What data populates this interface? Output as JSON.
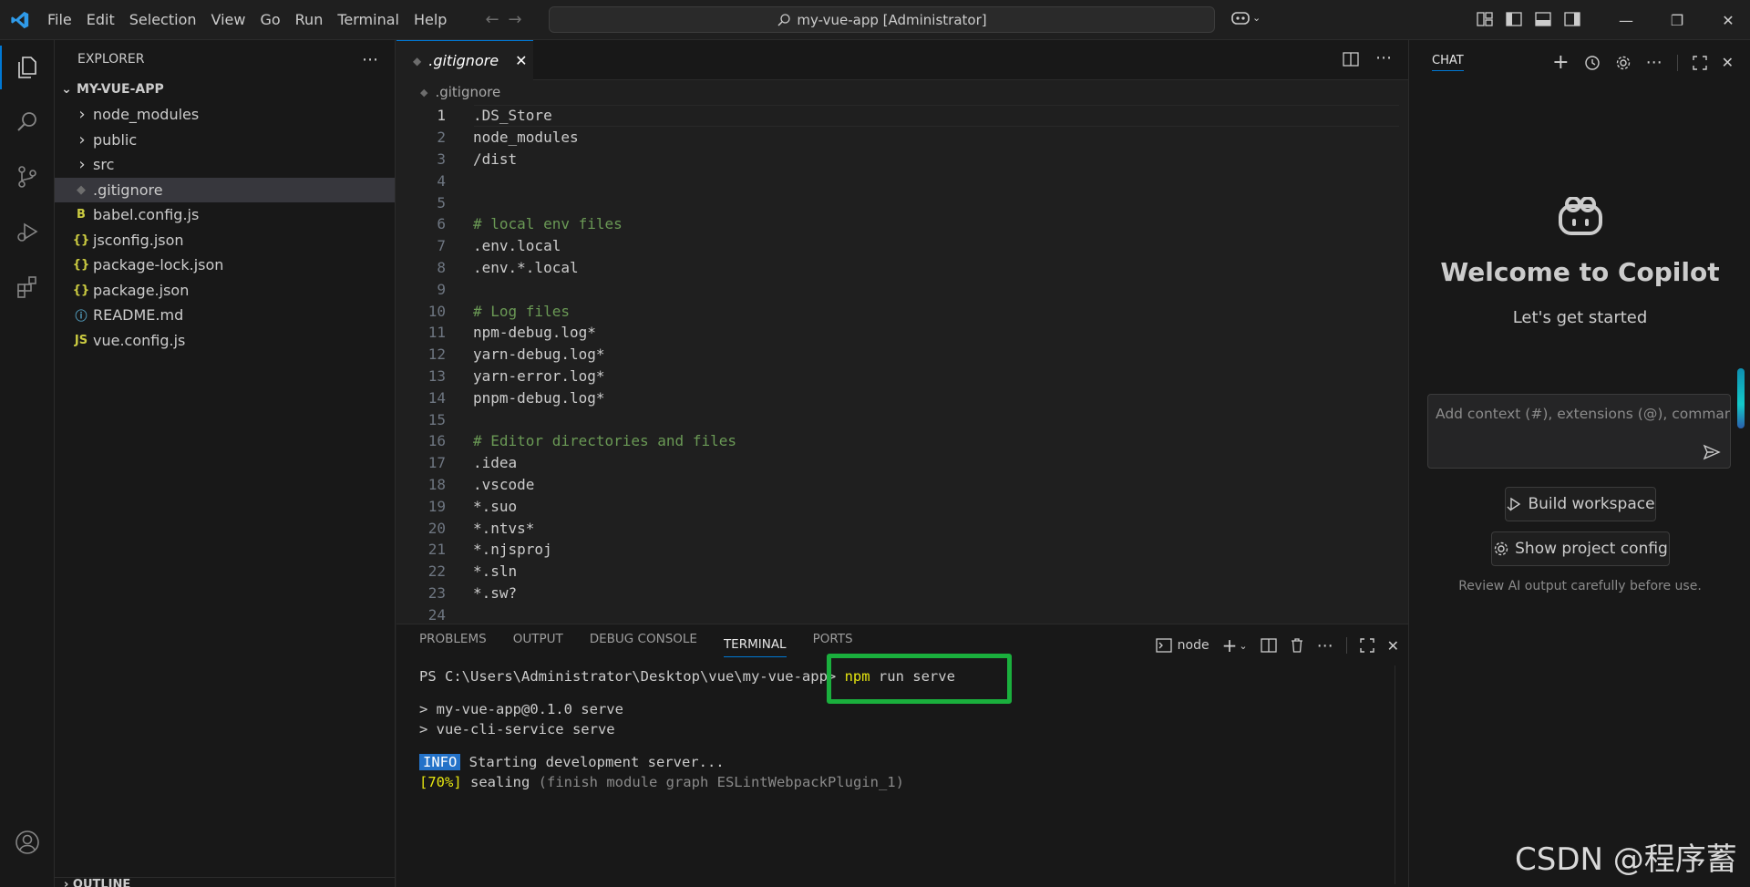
{
  "menu": [
    "File",
    "Edit",
    "Selection",
    "View",
    "Go",
    "Run",
    "Terminal",
    "Help"
  ],
  "command_center": "my-vue-app [Administrator]",
  "explorer": {
    "title": "EXPLORER",
    "folder": "MY-VUE-APP",
    "items": [
      {
        "name": "node_modules",
        "type": "folder",
        "icon": "chevron-right-icon"
      },
      {
        "name": "public",
        "type": "folder",
        "icon": "chevron-right-icon"
      },
      {
        "name": "src",
        "type": "folder",
        "icon": "chevron-right-icon"
      },
      {
        "name": ".gitignore",
        "type": "file",
        "icon": "git-diamond-icon",
        "glyph": "◆",
        "color": "#6d6d6d",
        "selected": true
      },
      {
        "name": "babel.config.js",
        "type": "file",
        "icon": "babel-icon",
        "glyph": "B",
        "color": "#cbcb41"
      },
      {
        "name": "jsconfig.json",
        "type": "file",
        "icon": "json-braces-icon",
        "glyph": "{}",
        "color": "#cbcb41"
      },
      {
        "name": "package-lock.json",
        "type": "file",
        "icon": "json-braces-icon",
        "glyph": "{}",
        "color": "#cbcb41"
      },
      {
        "name": "package.json",
        "type": "file",
        "icon": "json-braces-icon",
        "glyph": "{}",
        "color": "#cbcb41"
      },
      {
        "name": "README.md",
        "type": "file",
        "icon": "info-icon",
        "glyph": "ⓘ",
        "color": "#519aba"
      },
      {
        "name": "vue.config.js",
        "type": "file",
        "icon": "js-icon",
        "glyph": "JS",
        "color": "#cbcb41"
      }
    ],
    "outline": "OUTLINE"
  },
  "editor": {
    "tab_label": ".gitignore",
    "breadcrumb": ".gitignore",
    "lines": [
      {
        "n": "1",
        "text": ".DS_Store",
        "comment": false
      },
      {
        "n": "2",
        "text": "node_modules",
        "comment": false
      },
      {
        "n": "3",
        "text": "/dist",
        "comment": false
      },
      {
        "n": "4",
        "text": "",
        "comment": false
      },
      {
        "n": "5",
        "text": "",
        "comment": false
      },
      {
        "n": "6",
        "text": "# local env files",
        "comment": true
      },
      {
        "n": "7",
        "text": ".env.local",
        "comment": false
      },
      {
        "n": "8",
        "text": ".env.*.local",
        "comment": false
      },
      {
        "n": "9",
        "text": "",
        "comment": false
      },
      {
        "n": "10",
        "text": "# Log files",
        "comment": true
      },
      {
        "n": "11",
        "text": "npm-debug.log*",
        "comment": false
      },
      {
        "n": "12",
        "text": "yarn-debug.log*",
        "comment": false
      },
      {
        "n": "13",
        "text": "yarn-error.log*",
        "comment": false
      },
      {
        "n": "14",
        "text": "pnpm-debug.log*",
        "comment": false
      },
      {
        "n": "15",
        "text": "",
        "comment": false
      },
      {
        "n": "16",
        "text": "# Editor directories and files",
        "comment": true
      },
      {
        "n": "17",
        "text": ".idea",
        "comment": false
      },
      {
        "n": "18",
        "text": ".vscode",
        "comment": false
      },
      {
        "n": "19",
        "text": "*.suo",
        "comment": false
      },
      {
        "n": "20",
        "text": "*.ntvs*",
        "comment": false
      },
      {
        "n": "21",
        "text": "*.njsproj",
        "comment": false
      },
      {
        "n": "22",
        "text": "*.sln",
        "comment": false
      },
      {
        "n": "23",
        "text": "*.sw?",
        "comment": false
      },
      {
        "n": "24",
        "text": "",
        "comment": false
      }
    ]
  },
  "panel": {
    "tabs": [
      "PROBLEMS",
      "OUTPUT",
      "DEBUG CONSOLE",
      "TERMINAL",
      "PORTS"
    ],
    "active_tab": "TERMINAL",
    "terminal_name": "node",
    "prompt": "PS C:\\Users\\Administrator\\Desktop\\vue\\my-vue-app> ",
    "cmd_npm": "npm",
    "cmd_rest": " run serve",
    "out1": "> my-vue-app@0.1.0 serve",
    "out2": "> vue-cli-service serve",
    "info_badge": "INFO",
    "info_text": " Starting development server...",
    "progress": "[70%]",
    "progress_text": " sealing ",
    "progress_detail": "(finish module graph ESLintWebpackPlugin_1)"
  },
  "chat": {
    "title": "CHAT",
    "welcome_title": "Welcome to Copilot",
    "welcome_sub": "Let's get started",
    "input_placeholder": "Add context (#), extensions (@), commands",
    "build_label": "Build workspace",
    "config_label": "Show project config",
    "disclaimer": "Review AI output carefully before use."
  },
  "watermark": "CSDN @程序蓄",
  "colors": {
    "accent": "#0078d4",
    "highlight_box": "#1aaf3d",
    "comment": "#6a9955"
  }
}
